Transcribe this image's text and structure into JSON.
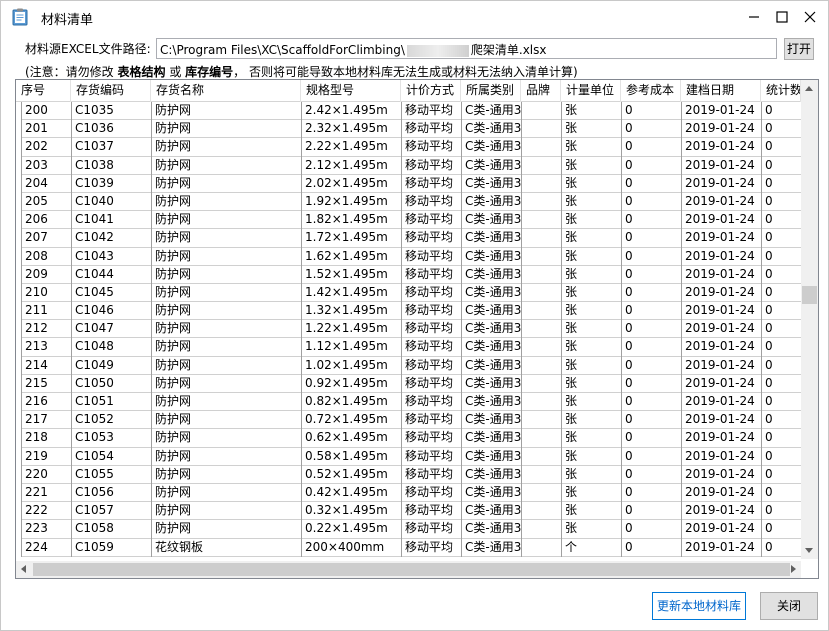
{
  "window": {
    "title": "材料清单",
    "controls": [
      "minimize-icon",
      "maximize-icon",
      "close-icon"
    ]
  },
  "source": {
    "label": "材料源EXCEL文件路径:",
    "path_prefix": "C:\\Program Files\\XC\\ScaffoldForClimbing\\",
    "path_suffix": "爬架清单.xlsx",
    "open_label": "打开"
  },
  "notice": {
    "prefix": "(注意：请勿修改 ",
    "bold1": "表格结构",
    "mid": " 或 ",
    "bold2": "库存编号",
    "suffix": "， 否则将可能导致本地材料库无法生成或材料无法纳入清单计算)"
  },
  "table": {
    "headers": [
      "序号",
      "存货编码",
      "存货名称",
      "规格型号",
      "计价方式",
      "所属类别",
      "品牌",
      "计量单位",
      "参考成本",
      "建档日期",
      "统计数"
    ],
    "rows": [
      [
        "200",
        "C1035",
        "防护网",
        "2.42×1.495m",
        "移动平均",
        "C类-通用3",
        "",
        "张",
        "0",
        "2019-01-24",
        "0"
      ],
      [
        "201",
        "C1036",
        "防护网",
        "2.32×1.495m",
        "移动平均",
        "C类-通用3",
        "",
        "张",
        "0",
        "2019-01-24",
        "0"
      ],
      [
        "202",
        "C1037",
        "防护网",
        "2.22×1.495m",
        "移动平均",
        "C类-通用3",
        "",
        "张",
        "0",
        "2019-01-24",
        "0"
      ],
      [
        "203",
        "C1038",
        "防护网",
        "2.12×1.495m",
        "移动平均",
        "C类-通用3",
        "",
        "张",
        "0",
        "2019-01-24",
        "0"
      ],
      [
        "204",
        "C1039",
        "防护网",
        "2.02×1.495m",
        "移动平均",
        "C类-通用3",
        "",
        "张",
        "0",
        "2019-01-24",
        "0"
      ],
      [
        "205",
        "C1040",
        "防护网",
        "1.92×1.495m",
        "移动平均",
        "C类-通用3",
        "",
        "张",
        "0",
        "2019-01-24",
        "0"
      ],
      [
        "206",
        "C1041",
        "防护网",
        "1.82×1.495m",
        "移动平均",
        "C类-通用3",
        "",
        "张",
        "0",
        "2019-01-24",
        "0"
      ],
      [
        "207",
        "C1042",
        "防护网",
        "1.72×1.495m",
        "移动平均",
        "C类-通用3",
        "",
        "张",
        "0",
        "2019-01-24",
        "0"
      ],
      [
        "208",
        "C1043",
        "防护网",
        "1.62×1.495m",
        "移动平均",
        "C类-通用3",
        "",
        "张",
        "0",
        "2019-01-24",
        "0"
      ],
      [
        "209",
        "C1044",
        "防护网",
        "1.52×1.495m",
        "移动平均",
        "C类-通用3",
        "",
        "张",
        "0",
        "2019-01-24",
        "0"
      ],
      [
        "210",
        "C1045",
        "防护网",
        "1.42×1.495m",
        "移动平均",
        "C类-通用3",
        "",
        "张",
        "0",
        "2019-01-24",
        "0"
      ],
      [
        "211",
        "C1046",
        "防护网",
        "1.32×1.495m",
        "移动平均",
        "C类-通用3",
        "",
        "张",
        "0",
        "2019-01-24",
        "0"
      ],
      [
        "212",
        "C1047",
        "防护网",
        "1.22×1.495m",
        "移动平均",
        "C类-通用3",
        "",
        "张",
        "0",
        "2019-01-24",
        "0"
      ],
      [
        "213",
        "C1048",
        "防护网",
        "1.12×1.495m",
        "移动平均",
        "C类-通用3",
        "",
        "张",
        "0",
        "2019-01-24",
        "0"
      ],
      [
        "214",
        "C1049",
        "防护网",
        "1.02×1.495m",
        "移动平均",
        "C类-通用3",
        "",
        "张",
        "0",
        "2019-01-24",
        "0"
      ],
      [
        "215",
        "C1050",
        "防护网",
        "0.92×1.495m",
        "移动平均",
        "C类-通用3",
        "",
        "张",
        "0",
        "2019-01-24",
        "0"
      ],
      [
        "216",
        "C1051",
        "防护网",
        "0.82×1.495m",
        "移动平均",
        "C类-通用3",
        "",
        "张",
        "0",
        "2019-01-24",
        "0"
      ],
      [
        "217",
        "C1052",
        "防护网",
        "0.72×1.495m",
        "移动平均",
        "C类-通用3",
        "",
        "张",
        "0",
        "2019-01-24",
        "0"
      ],
      [
        "218",
        "C1053",
        "防护网",
        "0.62×1.495m",
        "移动平均",
        "C类-通用3",
        "",
        "张",
        "0",
        "2019-01-24",
        "0"
      ],
      [
        "219",
        "C1054",
        "防护网",
        "0.58×1.495m",
        "移动平均",
        "C类-通用3",
        "",
        "张",
        "0",
        "2019-01-24",
        "0"
      ],
      [
        "220",
        "C1055",
        "防护网",
        "0.52×1.495m",
        "移动平均",
        "C类-通用3",
        "",
        "张",
        "0",
        "2019-01-24",
        "0"
      ],
      [
        "221",
        "C1056",
        "防护网",
        "0.42×1.495m",
        "移动平均",
        "C类-通用3",
        "",
        "张",
        "0",
        "2019-01-24",
        "0"
      ],
      [
        "222",
        "C1057",
        "防护网",
        "0.32×1.495m",
        "移动平均",
        "C类-通用3",
        "",
        "张",
        "0",
        "2019-01-24",
        "0"
      ],
      [
        "223",
        "C1058",
        "防护网",
        "0.22×1.495m",
        "移动平均",
        "C类-通用3",
        "",
        "张",
        "0",
        "2019-01-24",
        "0"
      ],
      [
        "224",
        "C1059",
        "花纹钢板",
        "200×400mm",
        "移动平均",
        "C类-通用3",
        "",
        "个",
        "0",
        "2019-01-24",
        "0"
      ]
    ]
  },
  "footer": {
    "update_label": "更新本地材料库",
    "close_label": "关闭"
  },
  "colors": {
    "accent": "#0078d7",
    "grid_border": "#828790",
    "scroll_bg": "#f0f0f0"
  }
}
